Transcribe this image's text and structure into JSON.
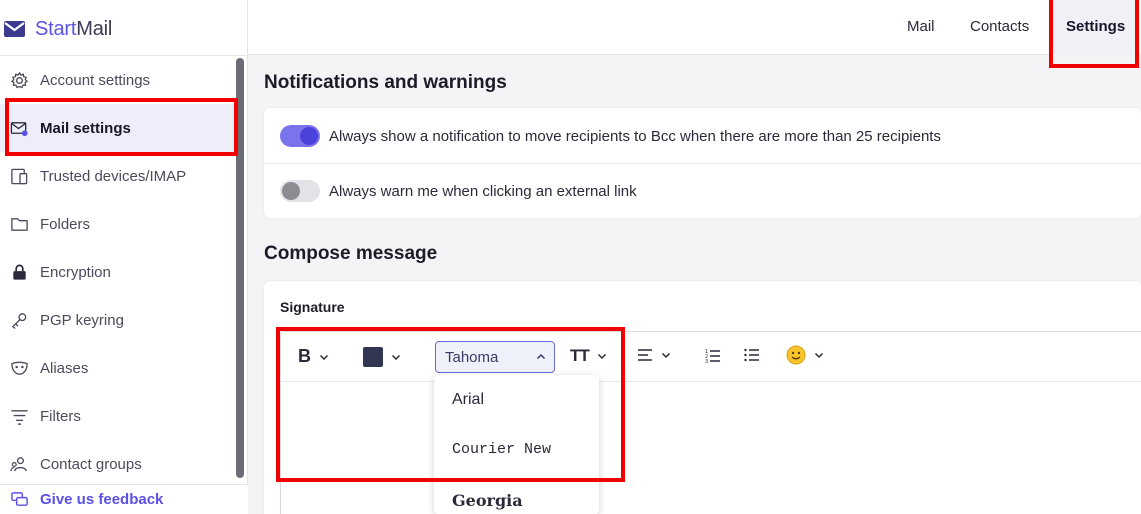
{
  "brand": {
    "start": "Start",
    "mail": "Mail"
  },
  "sidebar": {
    "items": [
      {
        "label": "Account settings",
        "icon": "gear-icon"
      },
      {
        "label": "Mail settings",
        "icon": "mail-settings-icon",
        "active": true
      },
      {
        "label": "Trusted devices/IMAP",
        "icon": "devices-icon"
      },
      {
        "label": "Folders",
        "icon": "folder-icon"
      },
      {
        "label": "Encryption",
        "icon": "lock-icon"
      },
      {
        "label": "PGP keyring",
        "icon": "key-icon"
      },
      {
        "label": "Aliases",
        "icon": "mask-icon"
      },
      {
        "label": "Filters",
        "icon": "filter-icon"
      },
      {
        "label": "Contact groups",
        "icon": "contact-group-icon"
      }
    ],
    "feedback": "Give us feedback"
  },
  "topnav": {
    "mail": "Mail",
    "contacts": "Contacts",
    "settings": "Settings"
  },
  "notifications": {
    "title": "Notifications and warnings",
    "bcc_label": "Always show a notification to move recipients to Bcc when there are more than 25 recipients",
    "bcc_on": true,
    "external_label": "Always warn me when clicking an external link",
    "external_on": false
  },
  "compose": {
    "title": "Compose message",
    "signature_label": "Signature",
    "toolbar": {
      "bold": "B",
      "font_selected": "Tahoma",
      "text_size": "TT",
      "text_color": "#333652"
    },
    "font_options": [
      "Arial",
      "Courier New",
      "Georgia"
    ]
  },
  "colors": {
    "accent": "#5b51e6",
    "highlight": "#f20000"
  }
}
